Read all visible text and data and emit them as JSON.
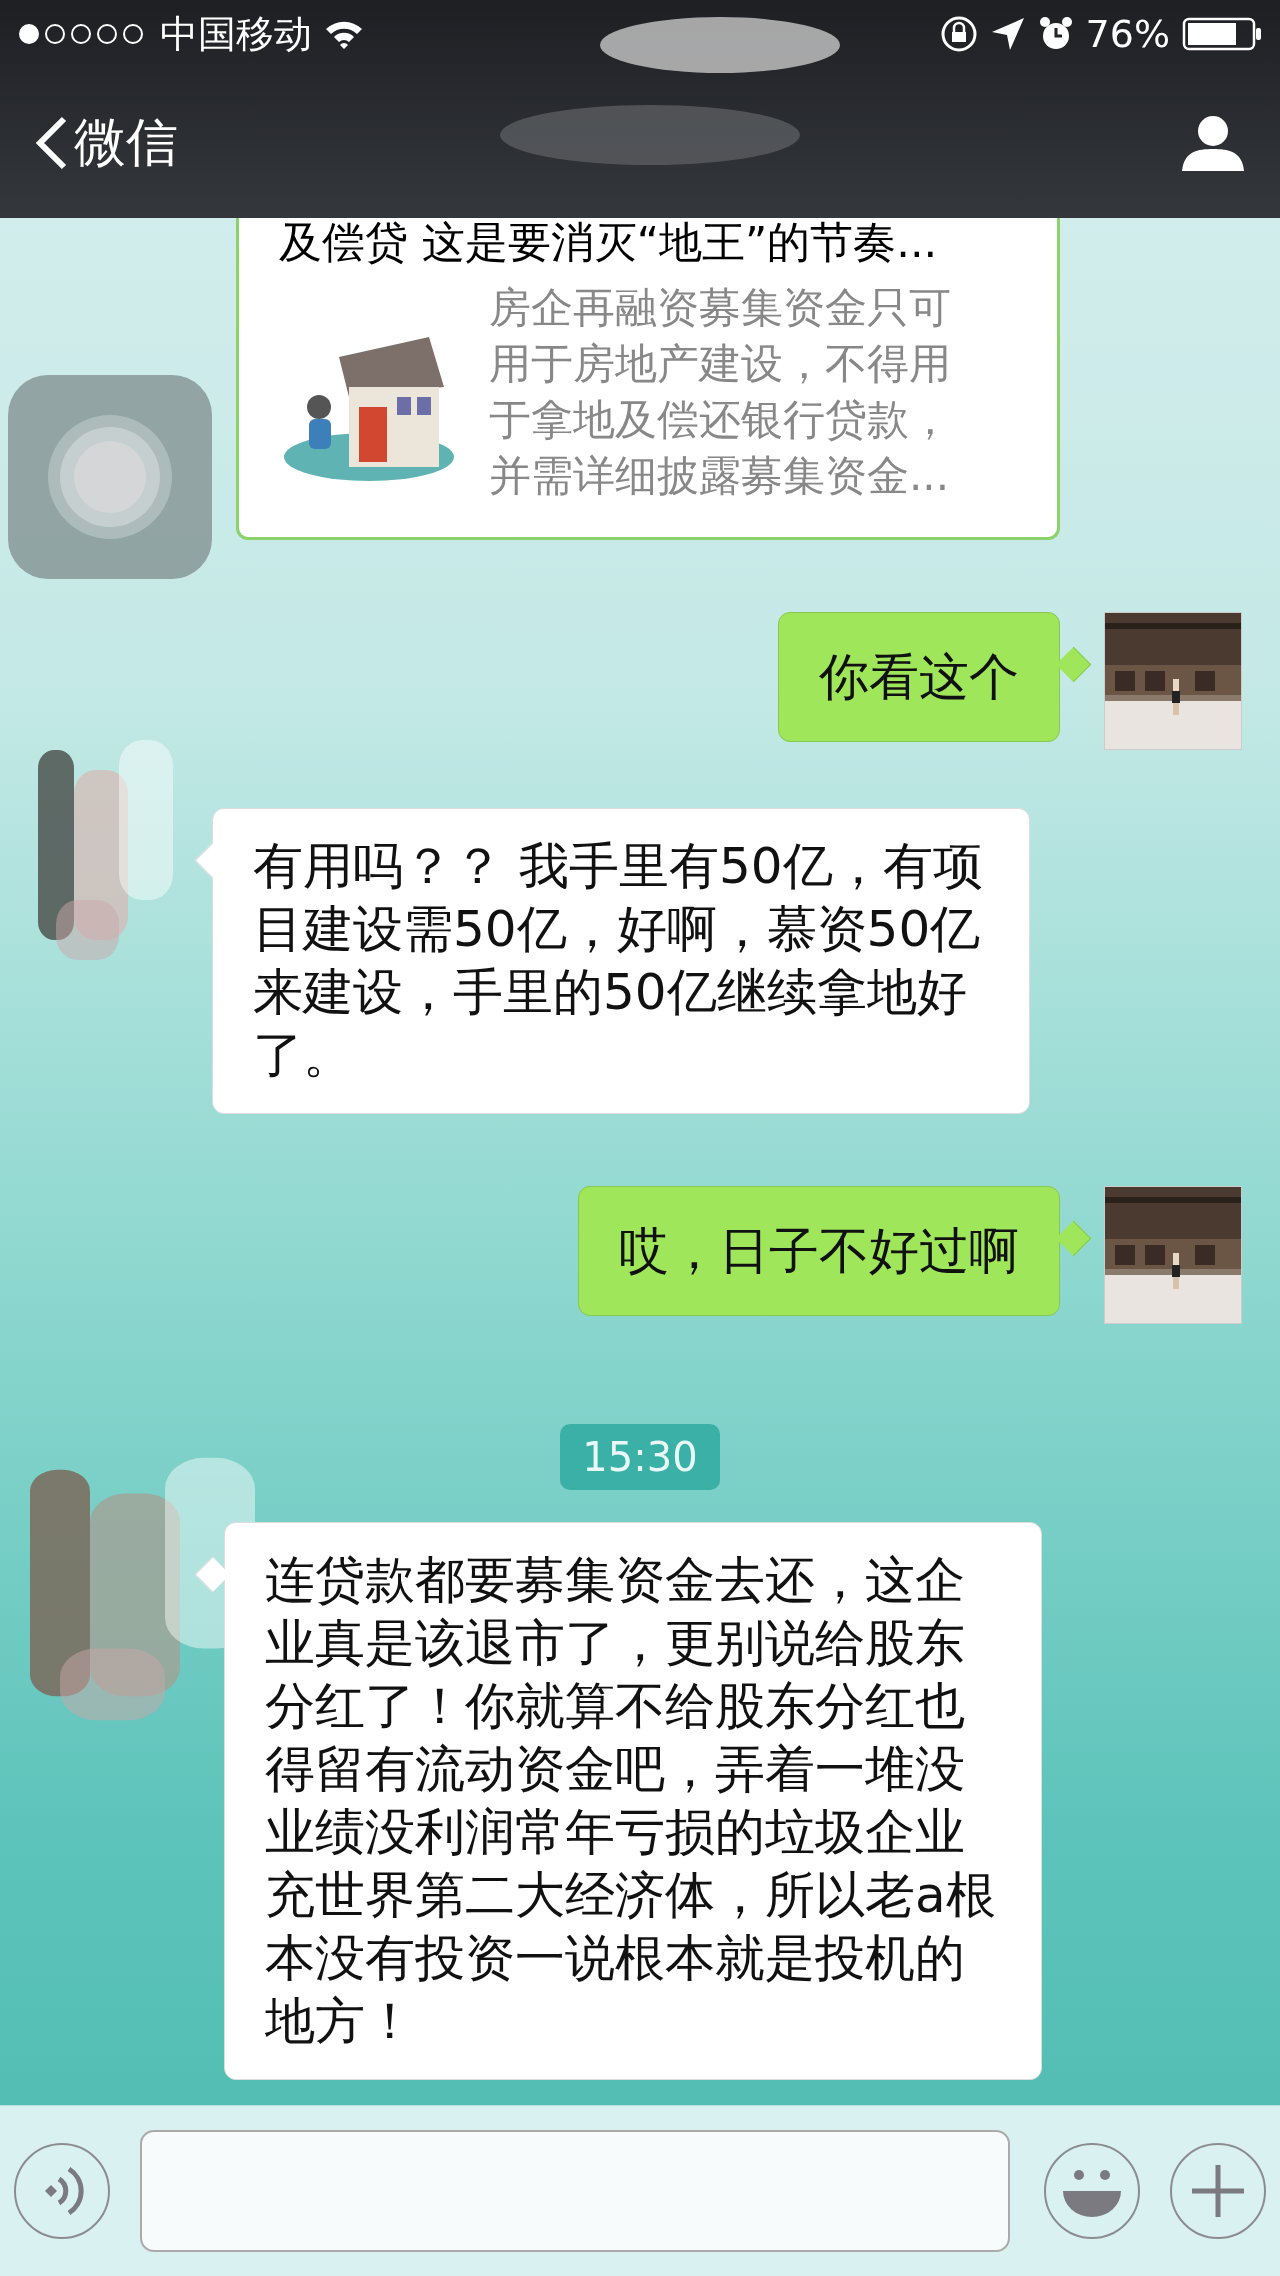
{
  "status_bar": {
    "carrier": "中国移动",
    "battery": "76%"
  },
  "nav": {
    "back": "微信"
  },
  "messages": [
    {
      "kind": "article",
      "title": "及偿贷 这是要消灭“地王”的节奏...",
      "summary": "房企再融资募集资金只可用于房地产建设，不得用于拿地及偿还银行贷款，并需详细披露募集资金..."
    },
    {
      "kind": "sent",
      "text": "你看这个"
    },
    {
      "kind": "received",
      "text": "有用吗？？ 我手里有50亿，有项目建设需50亿，好啊，慕资50亿来建设，手里的50亿继续拿地好了。"
    },
    {
      "kind": "sent",
      "text": "哎，日子不好过啊"
    },
    {
      "kind": "time",
      "text": "15:30"
    },
    {
      "kind": "received",
      "text": "连贷款都要募集资金去还，这企业真是该退市了，更别说给股东分红了！你就算不给股东分红也得留有流动资金吧，弄着一堆没业绩没利润常年亏损的垃圾企业充世界第二大经济体，所以老a根本没有投资一说根本就是投机的地方！"
    }
  ]
}
